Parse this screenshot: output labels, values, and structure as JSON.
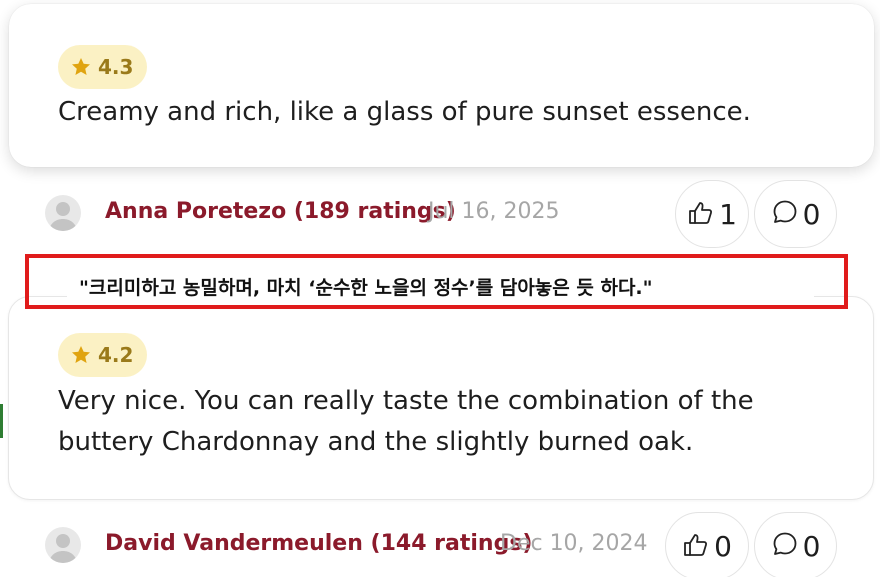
{
  "reviews": [
    {
      "rating": "4.3",
      "text": "Creamy and rich, like a glass of pure sunset essence.",
      "author": "Anna Poretezo (189 ratings)",
      "date": "Jul 16, 2025",
      "likes": "1",
      "comments": "0"
    },
    {
      "rating": "4.2",
      "text": "Very nice. You can really taste the combination of the buttery Chardonnay and the slightly burned oak.",
      "author": "David Vandermeulen (144 ratings)",
      "date": "Dec 10, 2024",
      "likes": "0",
      "comments": "0"
    }
  ],
  "translation_overlay": {
    "text": "\"크리미하고 농밀하며, 마치 ‘순수한 노을의 정수’를 담아놓은 듯 하다.\""
  },
  "colors": {
    "author": "#8b1a2b",
    "rating_badge_bg": "#fbf1c4",
    "star": "#e0a410",
    "highlight_border": "#e01b1b"
  },
  "icons": {
    "rating": "star-icon",
    "like": "thumbs-up-icon",
    "comment": "speech-bubble-icon",
    "avatar": "user-avatar-icon"
  }
}
